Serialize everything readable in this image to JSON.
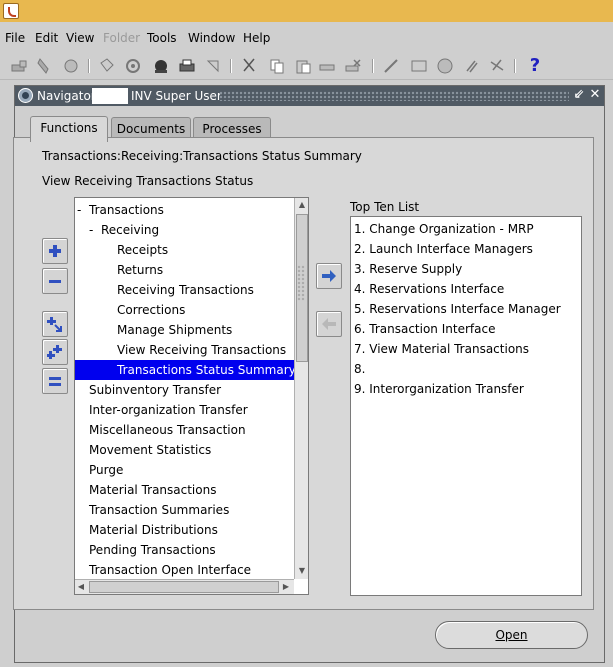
{
  "menubar": {
    "items": [
      {
        "label": "File",
        "enabled": true
      },
      {
        "label": "Edit",
        "enabled": true
      },
      {
        "label": "View",
        "enabled": true
      },
      {
        "label": "Folder",
        "enabled": false
      },
      {
        "label": "Tools",
        "enabled": true
      },
      {
        "label": "Window",
        "enabled": true
      },
      {
        "label": "Help",
        "enabled": true
      }
    ]
  },
  "toolbar": {
    "help_label": "?",
    "icons": [
      "new-icon",
      "find-icon",
      "navigator-icon",
      "save-icon",
      "next-step-icon",
      "switch-responsibility-icon",
      "print-icon",
      "close-form-icon",
      "cut-icon",
      "copy-icon",
      "paste-icon",
      "clear-record-icon",
      "delete-record-icon",
      "edit-field-icon",
      "zoom-icon",
      "translations-icon",
      "attachments-icon",
      "folder-tools-icon",
      "help-icon"
    ]
  },
  "window": {
    "title_prefix": "Navigator",
    "title_suffix": "INV Super User",
    "minimize_glyph": "⇙",
    "close_glyph": "✕"
  },
  "tabs": [
    {
      "label": "Functions",
      "active": true
    },
    {
      "label": "Documents",
      "active": false
    },
    {
      "label": "Processes",
      "active": false
    }
  ],
  "breadcrumb": "Transactions:Receiving:Transactions Status Summary",
  "description": "View Receiving Transactions Status",
  "tree": [
    {
      "label": "Transactions",
      "prefix": "-",
      "level": 0,
      "selected": false
    },
    {
      "label": "Receiving",
      "prefix": "-",
      "level": 1,
      "selected": false
    },
    {
      "label": "Receipts",
      "prefix": "",
      "level": 2,
      "selected": false
    },
    {
      "label": "Returns",
      "prefix": "",
      "level": 2,
      "selected": false
    },
    {
      "label": "Receiving Transactions",
      "prefix": "",
      "level": 2,
      "selected": false
    },
    {
      "label": "Corrections",
      "prefix": "",
      "level": 2,
      "selected": false
    },
    {
      "label": "Manage Shipments",
      "prefix": "",
      "level": 2,
      "selected": false
    },
    {
      "label": "View Receiving Transactions",
      "prefix": "",
      "level": 2,
      "selected": false
    },
    {
      "label": "Transactions Status Summary",
      "prefix": "",
      "level": 2,
      "selected": true
    },
    {
      "label": "Subinventory Transfer",
      "prefix": "",
      "level": 1,
      "selected": false
    },
    {
      "label": "Inter-organization Transfer",
      "prefix": "",
      "level": 1,
      "selected": false
    },
    {
      "label": "Miscellaneous Transaction",
      "prefix": "",
      "level": 1,
      "selected": false
    },
    {
      "label": "Movement Statistics",
      "prefix": "",
      "level": 1,
      "selected": false
    },
    {
      "label": "Purge",
      "prefix": "",
      "level": 1,
      "selected": false
    },
    {
      "label": "Material Transactions",
      "prefix": "",
      "level": 1,
      "selected": false
    },
    {
      "label": "Transaction Summaries",
      "prefix": "",
      "level": 1,
      "selected": false
    },
    {
      "label": "Material Distributions",
      "prefix": "",
      "level": 1,
      "selected": false
    },
    {
      "label": "Pending Transactions",
      "prefix": "",
      "level": 1,
      "selected": false
    },
    {
      "label": "Transaction Open Interface",
      "prefix": "",
      "level": 1,
      "selected": false
    }
  ],
  "top_ten": {
    "label": "Top Ten List",
    "items": [
      "1. Change Organization - MRP",
      "2. Launch Interface Managers",
      "3. Reserve Supply",
      "4. Reservations Interface",
      "5. Reservations Interface Manager",
      "6. Transaction Interface",
      "7. View Material Transactions",
      "8.",
      "9. Interorganization Transfer"
    ]
  },
  "open_button": {
    "label": "Open"
  },
  "colors": {
    "titlebar": "#e8b84f",
    "window_title": "#505a64",
    "selection": "#0000ee"
  }
}
